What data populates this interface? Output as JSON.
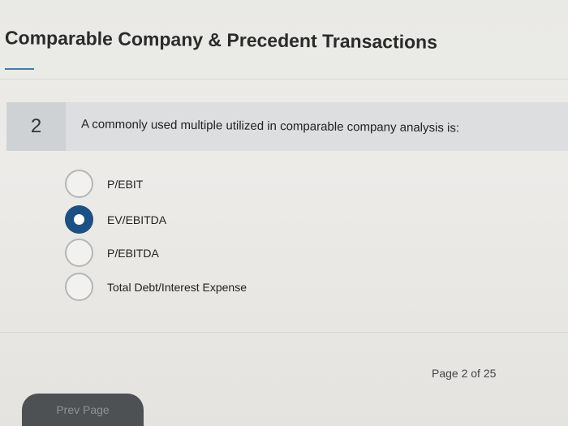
{
  "header": {
    "title": "Comparable Company & Precedent Transactions"
  },
  "question": {
    "number": "2",
    "text": "A commonly used multiple utilized in comparable company analysis is:",
    "options": [
      {
        "label": "P/EBIT",
        "selected": false
      },
      {
        "label": "EV/EBITDA",
        "selected": true
      },
      {
        "label": "P/EBITDA",
        "selected": false
      },
      {
        "label": "Total Debt/Interest Expense",
        "selected": false
      }
    ]
  },
  "footer": {
    "page_indicator": "Page 2 of 25",
    "prev_label": "Prev Page"
  },
  "colors": {
    "accent": "#1c4f82",
    "underline": "#3e7bb0"
  }
}
